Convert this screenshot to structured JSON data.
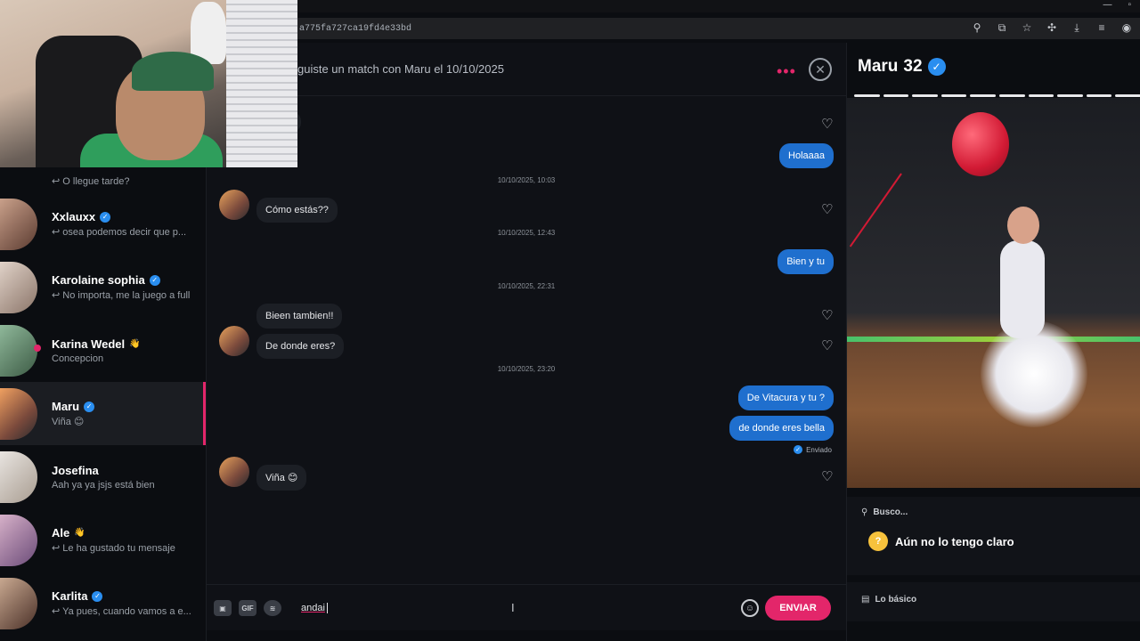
{
  "browser": {
    "url": "a775fa727ca19fd4e33bd"
  },
  "chat_header": {
    "title": "guiste un match con Maru el 10/10/2025"
  },
  "conversations": [
    {
      "name": "",
      "preview": "↩ O llegue tarde?",
      "verified": false
    },
    {
      "name": "Xxlauxx",
      "preview": "↩ osea podemos decir que p...",
      "verified": true
    },
    {
      "name": "Karolaine sophia",
      "preview": "↩ No importa, me la juego a full",
      "verified": true
    },
    {
      "name": "Karina Wedel",
      "preview": "Concepcion",
      "verified": false,
      "badge": "👋"
    },
    {
      "name": "Maru",
      "preview": "Viña 😊",
      "verified": true,
      "active": true
    },
    {
      "name": "Josefina",
      "preview": "Aah ya ya jsjs está bien",
      "verified": false
    },
    {
      "name": "Ale",
      "preview": "↩ Le ha gustado tu mensaje",
      "verified": false,
      "badge": "👋"
    },
    {
      "name": "Karlita",
      "preview": "↩ Ya pues, cuando vamos a e...",
      "verified": true
    }
  ],
  "messages": {
    "m1": "Holaaaa",
    "ts1": "10/10/2025, 10:03",
    "m2": "Cómo estás??",
    "ts2": "10/10/2025, 12:43",
    "m3": "Bien y tu",
    "ts3": "10/10/2025, 22:31",
    "m4": "Bieen tambien!!",
    "m5": "De donde eres?",
    "ts4": "10/10/2025, 23:20",
    "m6": "De Vitacura y tu ?",
    "m7": "de donde eres bella",
    "sent_status": "Enviado",
    "m8": "Viña 😊"
  },
  "composer": {
    "gif_label": "GIF",
    "input_value": "andai",
    "send_label": "ENVIAR"
  },
  "profile": {
    "name": "Maru",
    "age": "32",
    "photo_count": 10,
    "current_photo": 10,
    "busco_label": "Busco...",
    "busco_value": "Aún no lo tengo claro",
    "basics_label": "Lo básico"
  },
  "colors": {
    "accent": "#e3266a",
    "my_bubble": "#1f6fce",
    "verified": "#2a8ef0"
  }
}
